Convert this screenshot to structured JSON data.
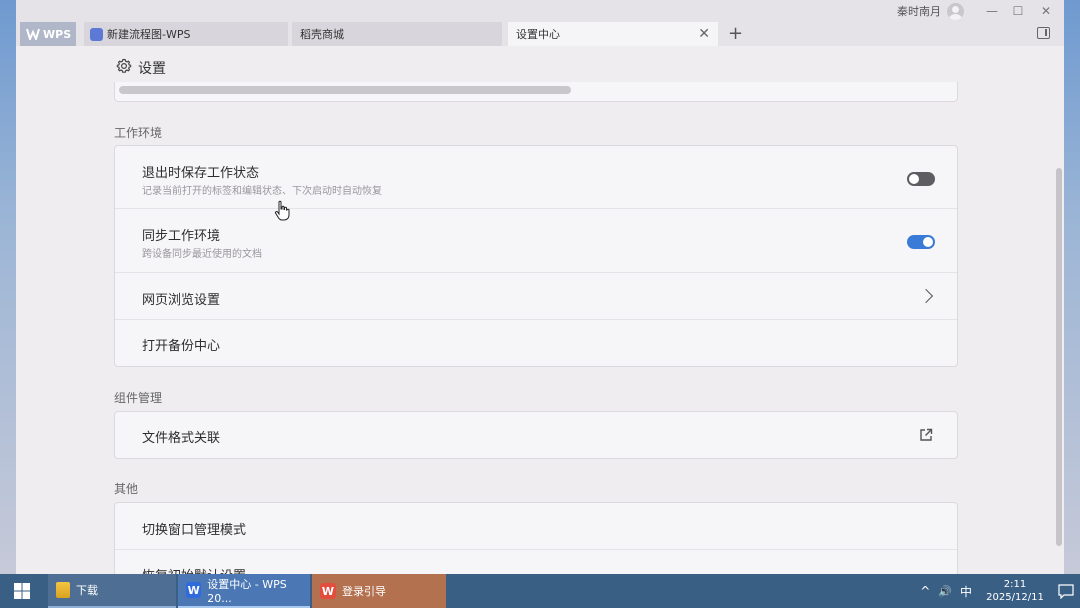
{
  "window": {
    "user_name": "秦时南月",
    "controls": {
      "minimize": "—",
      "maximize": "☐",
      "close": "✕"
    }
  },
  "tabs": [
    {
      "label": "WPS",
      "icon": "wps-logo-icon"
    },
    {
      "label": "新建流程图-WPS",
      "icon": "flowchart-icon"
    },
    {
      "label": "稻壳商城"
    },
    {
      "label": "设置中心",
      "active": true,
      "close": "✕"
    }
  ],
  "tab_add": "+",
  "header": {
    "title": "设置",
    "icon": "gear-icon"
  },
  "sections": {
    "workspace": {
      "label": "工作环境",
      "rows": [
        {
          "title": "退出时保存工作状态",
          "desc": "记录当前打开的标签和编辑状态、下次启动时自动恢复",
          "control": "toggle",
          "state": "off"
        },
        {
          "title": "同步工作环境",
          "desc": "跨设备同步最近使用的文档",
          "control": "toggle",
          "state": "on"
        },
        {
          "title": "网页浏览设置",
          "control": "chevron"
        },
        {
          "title": "打开备份中心"
        }
      ]
    },
    "components": {
      "label": "组件管理",
      "rows": [
        {
          "title": "文件格式关联",
          "control": "external-link"
        }
      ]
    },
    "other": {
      "label": "其他",
      "rows": [
        {
          "title": "切换窗口管理模式"
        },
        {
          "title": "恢复初始默认设置"
        }
      ]
    }
  },
  "colors": {
    "toggle_on": "#3a7bd8",
    "toggle_off": "#5e5d61",
    "taskbar": "#3a5f85"
  },
  "taskbar": {
    "items": [
      {
        "label": "下载",
        "icon": "folder-icon"
      },
      {
        "label": "设置中心 - WPS 20...",
        "icon": "wps-icon"
      },
      {
        "label": "登录引导",
        "icon": "wps-icon"
      }
    ],
    "tray": {
      "chevron": "^",
      "volume": "🔊",
      "ime": "中",
      "time": "2:11",
      "date": "2025/12/11"
    }
  }
}
